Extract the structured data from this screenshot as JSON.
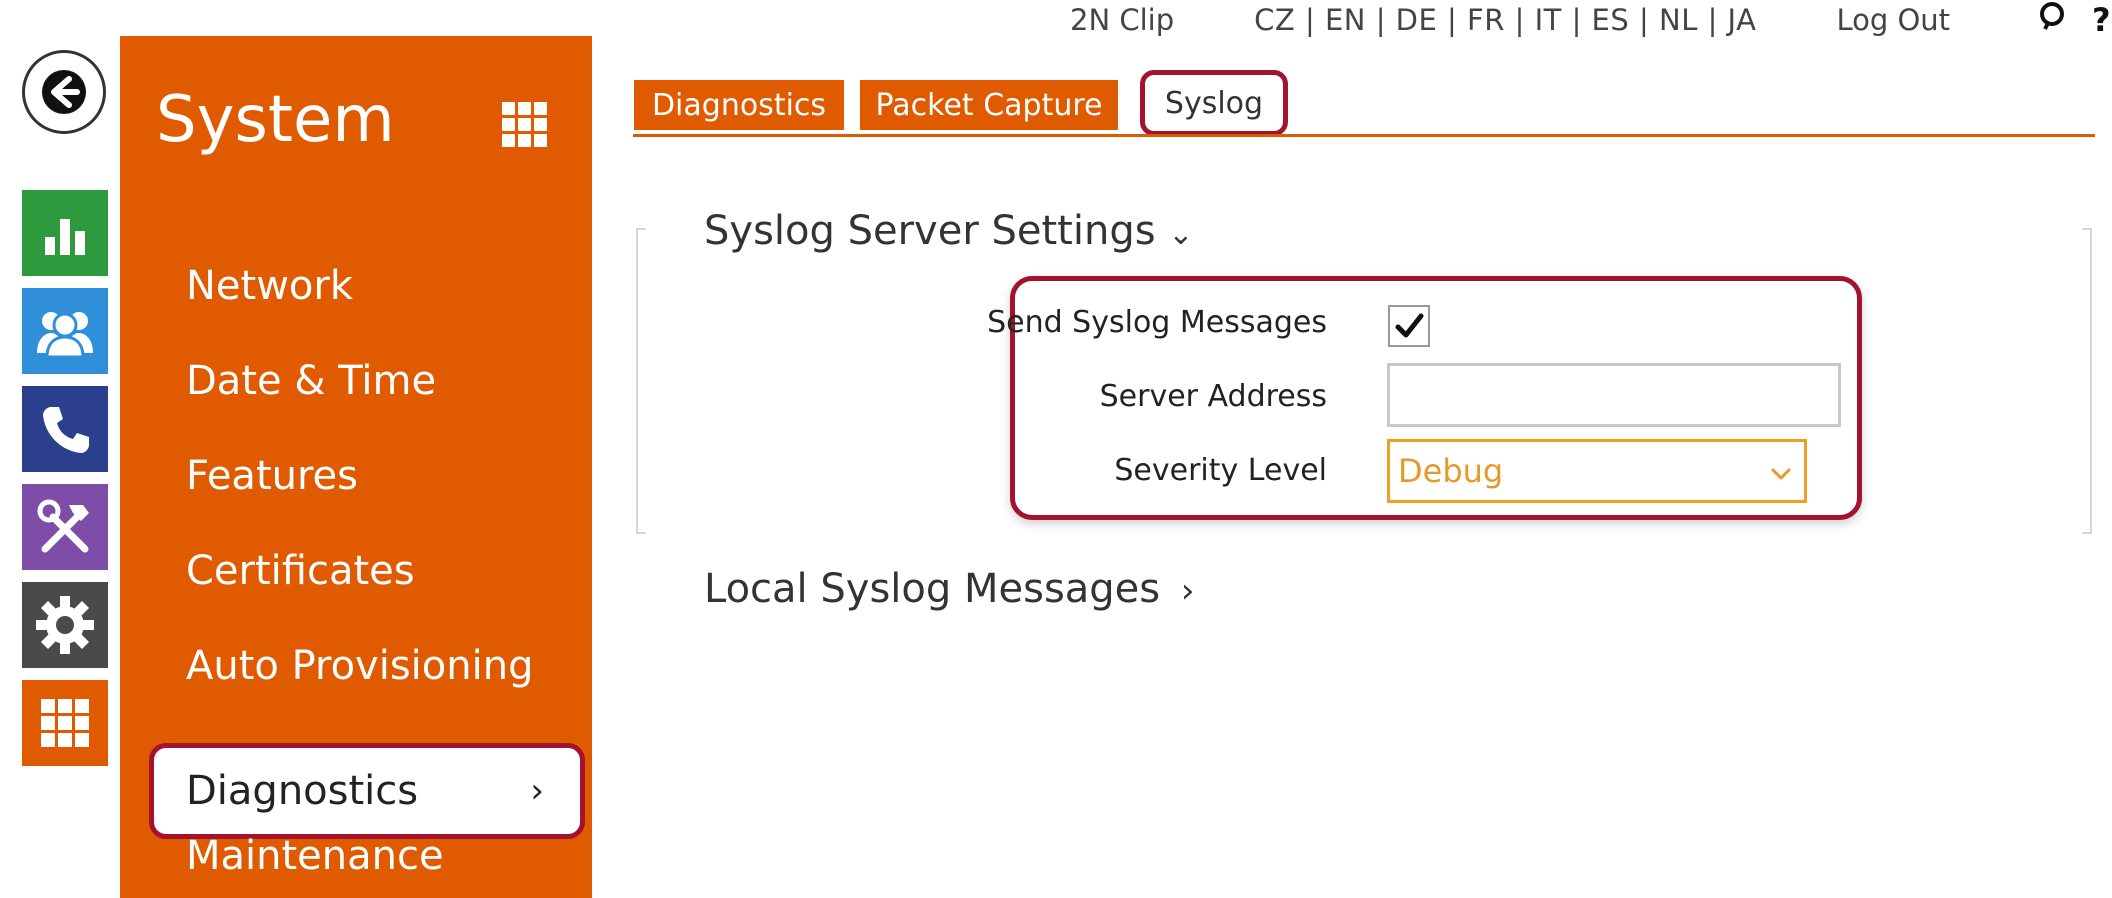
{
  "topbar": {
    "device": "2N Clip",
    "languages": "CZ | EN | DE | FR | IT | ES | NL | JA",
    "logout": "Log Out",
    "help": "?",
    "search_icon": "search-icon"
  },
  "rail": {
    "items": [
      {
        "icon": "bar-chart-icon",
        "color": "#2e9a3e"
      },
      {
        "icon": "users-icon",
        "color": "#2f8fd8"
      },
      {
        "icon": "phone-icon",
        "color": "#2b3f8c"
      },
      {
        "icon": "tools-icon",
        "color": "#7d4da8"
      },
      {
        "icon": "gear-icon",
        "color": "#4a4a4a"
      },
      {
        "icon": "grid-icon",
        "color": "#e05a00"
      }
    ]
  },
  "sidebar": {
    "title": "System",
    "color": "#e05a00",
    "items": [
      {
        "label": "Network"
      },
      {
        "label": "Date & Time"
      },
      {
        "label": "Features"
      },
      {
        "label": "Certificates"
      },
      {
        "label": "Auto Provisioning"
      },
      {
        "label": "Diagnostics",
        "chevron": "›"
      },
      {
        "label": "Maintenance"
      }
    ]
  },
  "tabs": [
    {
      "label": "Diagnostics"
    },
    {
      "label": "Packet Capture"
    },
    {
      "label": "Syslog"
    }
  ],
  "syslog_server": {
    "title": "Syslog Server Settings",
    "expand_glyph": "⌄",
    "send_label": "Send Syslog Messages",
    "send_checked": true,
    "address_label": "Server Address",
    "address_value": "",
    "severity_label": "Severity Level",
    "severity_value": "Debug"
  },
  "local_syslog": {
    "title": "Local Syslog Messages",
    "expand_glyph": "›"
  },
  "highlight_color": "#a3132d"
}
